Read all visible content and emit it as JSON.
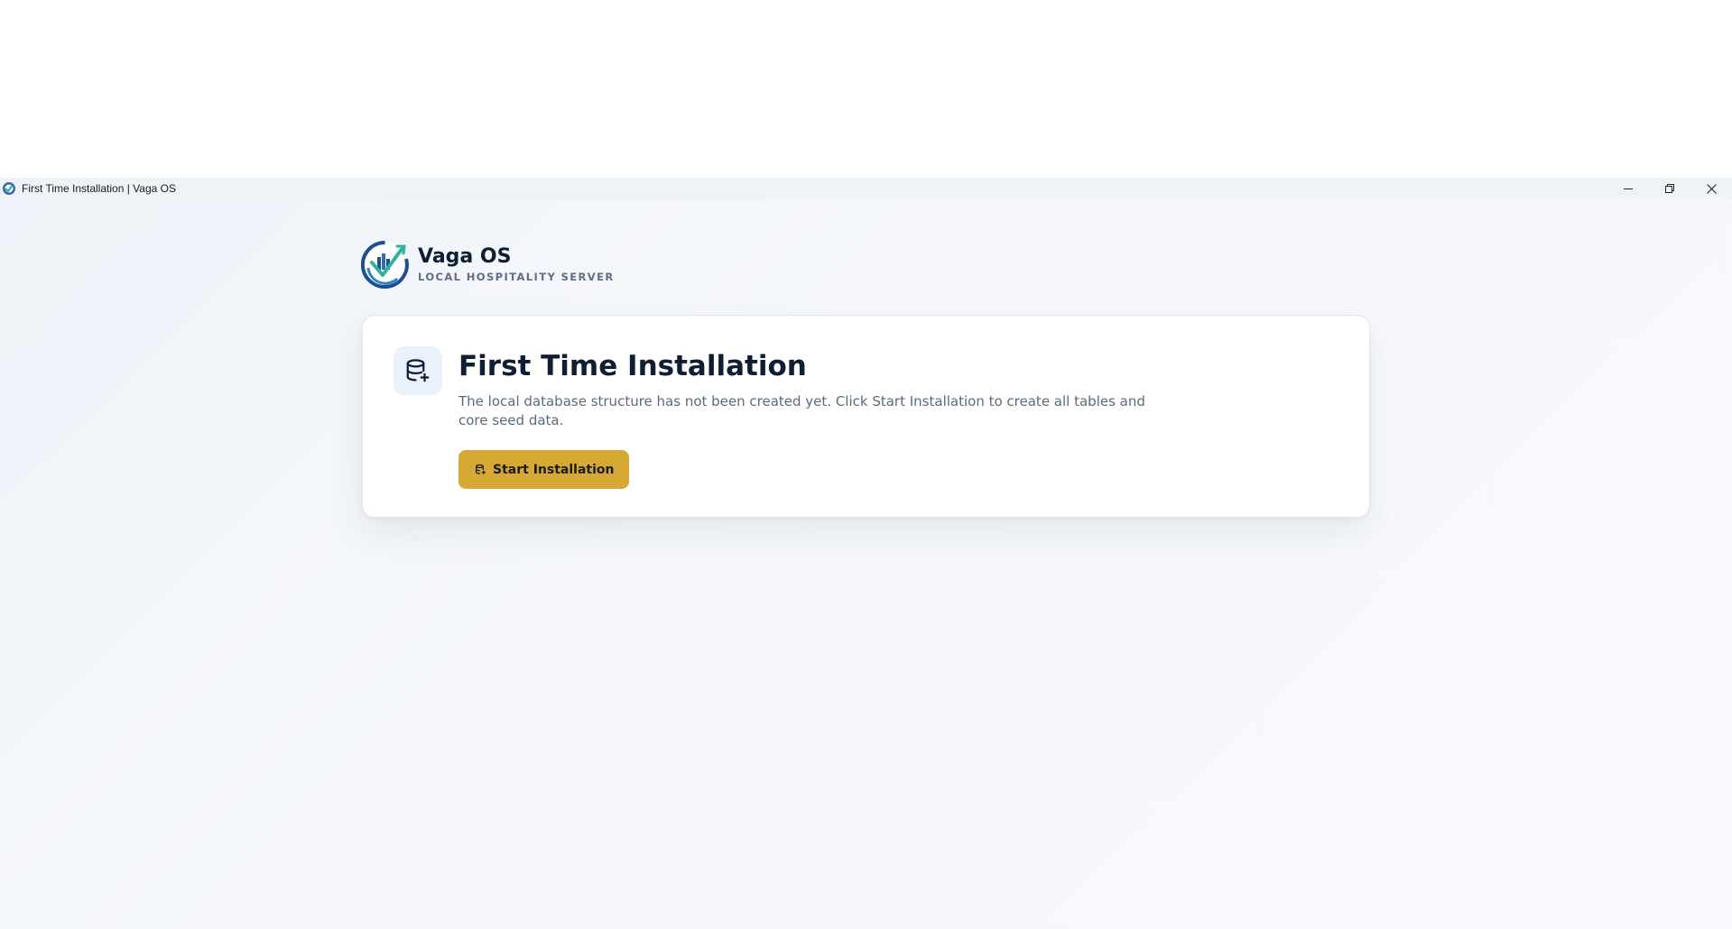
{
  "window": {
    "title": "First Time Installation | Vaga OS"
  },
  "window_controls": {
    "minimize_icon": "minimize-icon",
    "restore_icon": "restore-icon",
    "close_icon": "close-icon"
  },
  "brand": {
    "name": "Vaga OS",
    "subtitle": "LOCAL HOSPITALITY SERVER",
    "logo_icon": "vaga-logo-icon"
  },
  "card": {
    "icon": "database-plus-icon",
    "title": "First Time Installation",
    "description": "The local database structure has not been created yet. Click Start Installation to create all tables and core seed data.",
    "button_label": "Start Installation",
    "button_icon": "database-plus-icon"
  },
  "colors": {
    "accent": "#d6a935",
    "title_text": "#0f1e33",
    "muted_text": "#5a6a7c",
    "icon_tile_bg": "#e9f1fb",
    "window_bg": "#f6f8fb"
  }
}
